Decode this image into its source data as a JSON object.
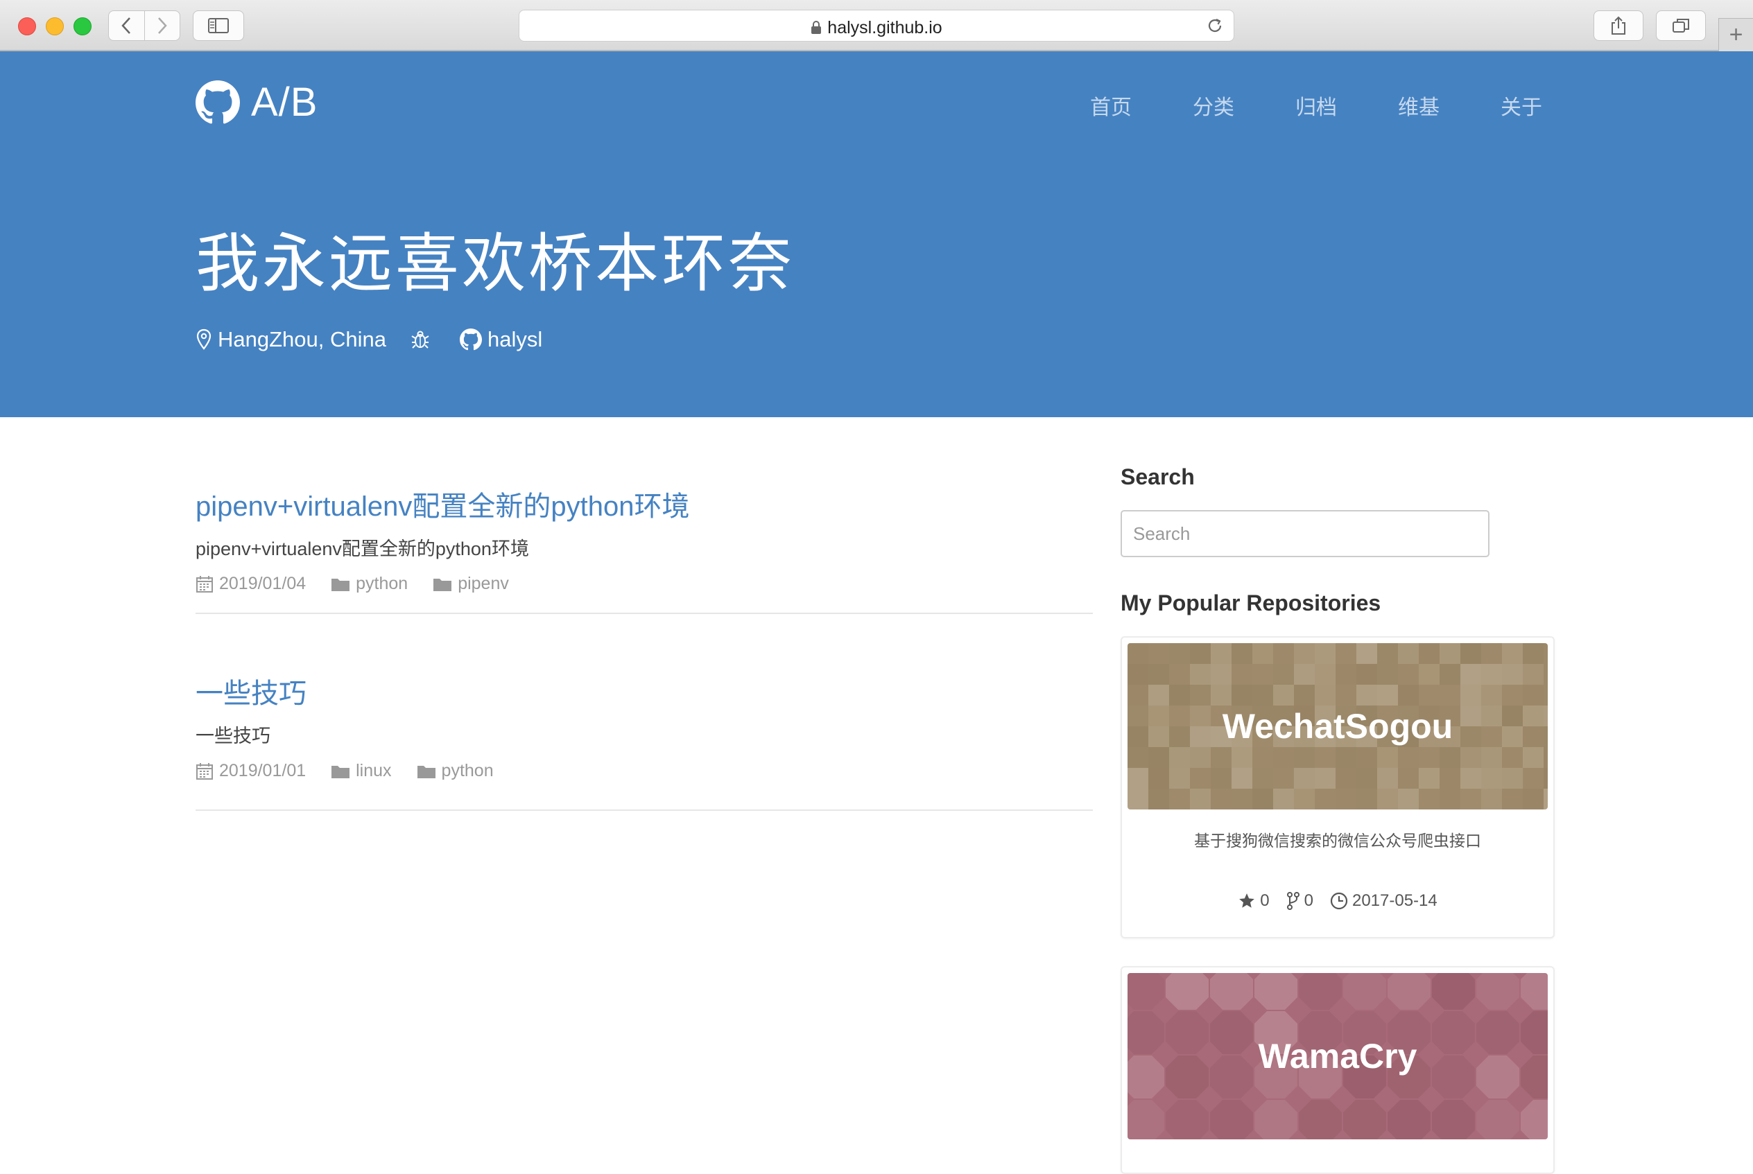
{
  "browser": {
    "url": "halysl.github.io",
    "new_tab_symbol": "+"
  },
  "site": {
    "brand": "A/B",
    "nav": [
      "首页",
      "分类",
      "归档",
      "维基",
      "关于"
    ],
    "hero_title": "我永远喜欢桥本环奈",
    "location": "HangZhou, China",
    "github_user": "halysl",
    "colors": {
      "header_bg": "#4582c2",
      "link": "#4582c2"
    }
  },
  "posts": [
    {
      "title": "pipenv+virtualenv配置全新的python环境",
      "excerpt": "pipenv+virtualenv配置全新的python环境",
      "date": "2019/01/04",
      "categories": [
        "python",
        "pipenv"
      ]
    },
    {
      "title": "一些技巧",
      "excerpt": "一些技巧",
      "date": "2019/01/01",
      "categories": [
        "linux",
        "python"
      ]
    }
  ],
  "sidebar": {
    "search_heading": "Search",
    "search_placeholder": "Search",
    "repos_heading": "My Popular Repositories",
    "repos": [
      {
        "name": "WechatSogou",
        "description": "基于搜狗微信搜索的微信公众号爬虫接口",
        "stars": "0",
        "forks": "0",
        "updated": "2017-05-14",
        "banner_color": "#a38f6f"
      },
      {
        "name": "WamaCry",
        "banner_color": "#a86a78"
      }
    ]
  }
}
